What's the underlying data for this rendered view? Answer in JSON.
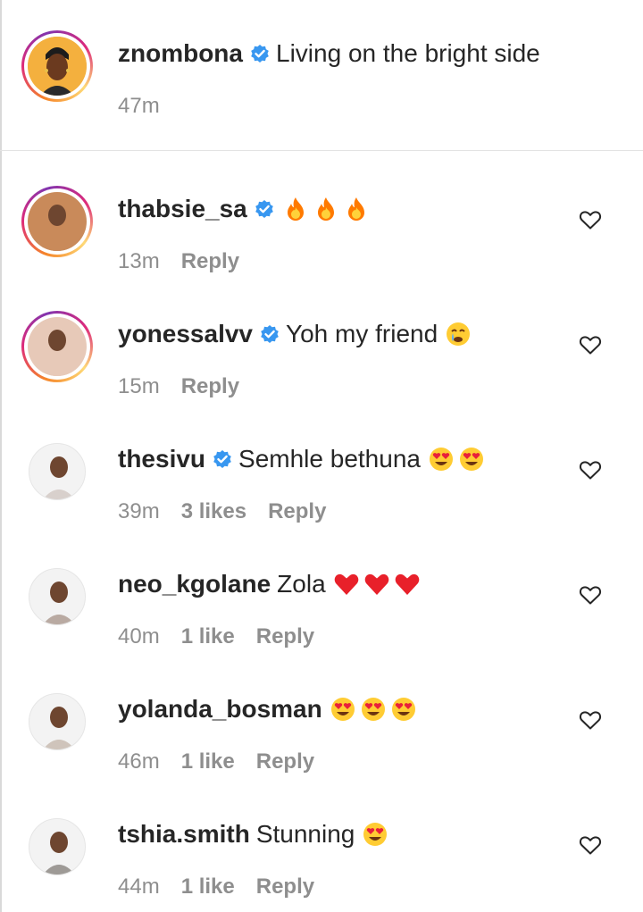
{
  "colors": {
    "text": "#262626",
    "secondary": "#8e8e8e",
    "verified": "#3897f0",
    "story_ring": [
      "#f58529",
      "#dd2a7b",
      "#8134af",
      "#feda77"
    ],
    "divider": "#e3e3e3"
  },
  "caption": {
    "username": "znombona",
    "verified": true,
    "text": "Living on the bright side",
    "time": "47m",
    "avatar_icon": "profile-photo"
  },
  "comments": [
    {
      "username": "thabsie_sa",
      "verified": true,
      "text": "",
      "emoji": [
        "fire",
        "fire",
        "fire"
      ],
      "time": "13m",
      "likes": "",
      "reply": "Reply",
      "story_ring": true,
      "avatar_icon": "profile-photo",
      "like_icon": "heart-outline-icon"
    },
    {
      "username": "yonessalvv",
      "verified": true,
      "text": "Yoh my friend",
      "emoji": [
        "crying-laughing"
      ],
      "time": "15m",
      "likes": "",
      "reply": "Reply",
      "story_ring": true,
      "avatar_icon": "profile-photo",
      "like_icon": "heart-outline-icon"
    },
    {
      "username": "thesivu",
      "verified": true,
      "text": "Semhle bethuna",
      "emoji": [
        "heart-eyes",
        "heart-eyes"
      ],
      "time": "39m",
      "likes": "3 likes",
      "reply": "Reply",
      "story_ring": false,
      "avatar_icon": "profile-photo",
      "like_icon": "heart-outline-icon"
    },
    {
      "username": "neo_kgolane",
      "verified": false,
      "text": "Zola",
      "emoji": [
        "red-heart",
        "red-heart",
        "red-heart"
      ],
      "time": "40m",
      "likes": "1 like",
      "reply": "Reply",
      "story_ring": false,
      "avatar_icon": "profile-photo",
      "like_icon": "heart-outline-icon"
    },
    {
      "username": "yolanda_bosman",
      "verified": false,
      "text": "",
      "emoji": [
        "heart-eyes",
        "heart-eyes",
        "heart-eyes"
      ],
      "time": "46m",
      "likes": "1 like",
      "reply": "Reply",
      "story_ring": false,
      "avatar_icon": "profile-photo",
      "like_icon": "heart-outline-icon"
    },
    {
      "username": "tshia.smith",
      "verified": false,
      "text": "Stunning",
      "emoji": [
        "heart-eyes"
      ],
      "time": "44m",
      "likes": "1 like",
      "reply": "Reply",
      "story_ring": false,
      "avatar_icon": "profile-photo",
      "like_icon": "heart-outline-icon"
    }
  ]
}
